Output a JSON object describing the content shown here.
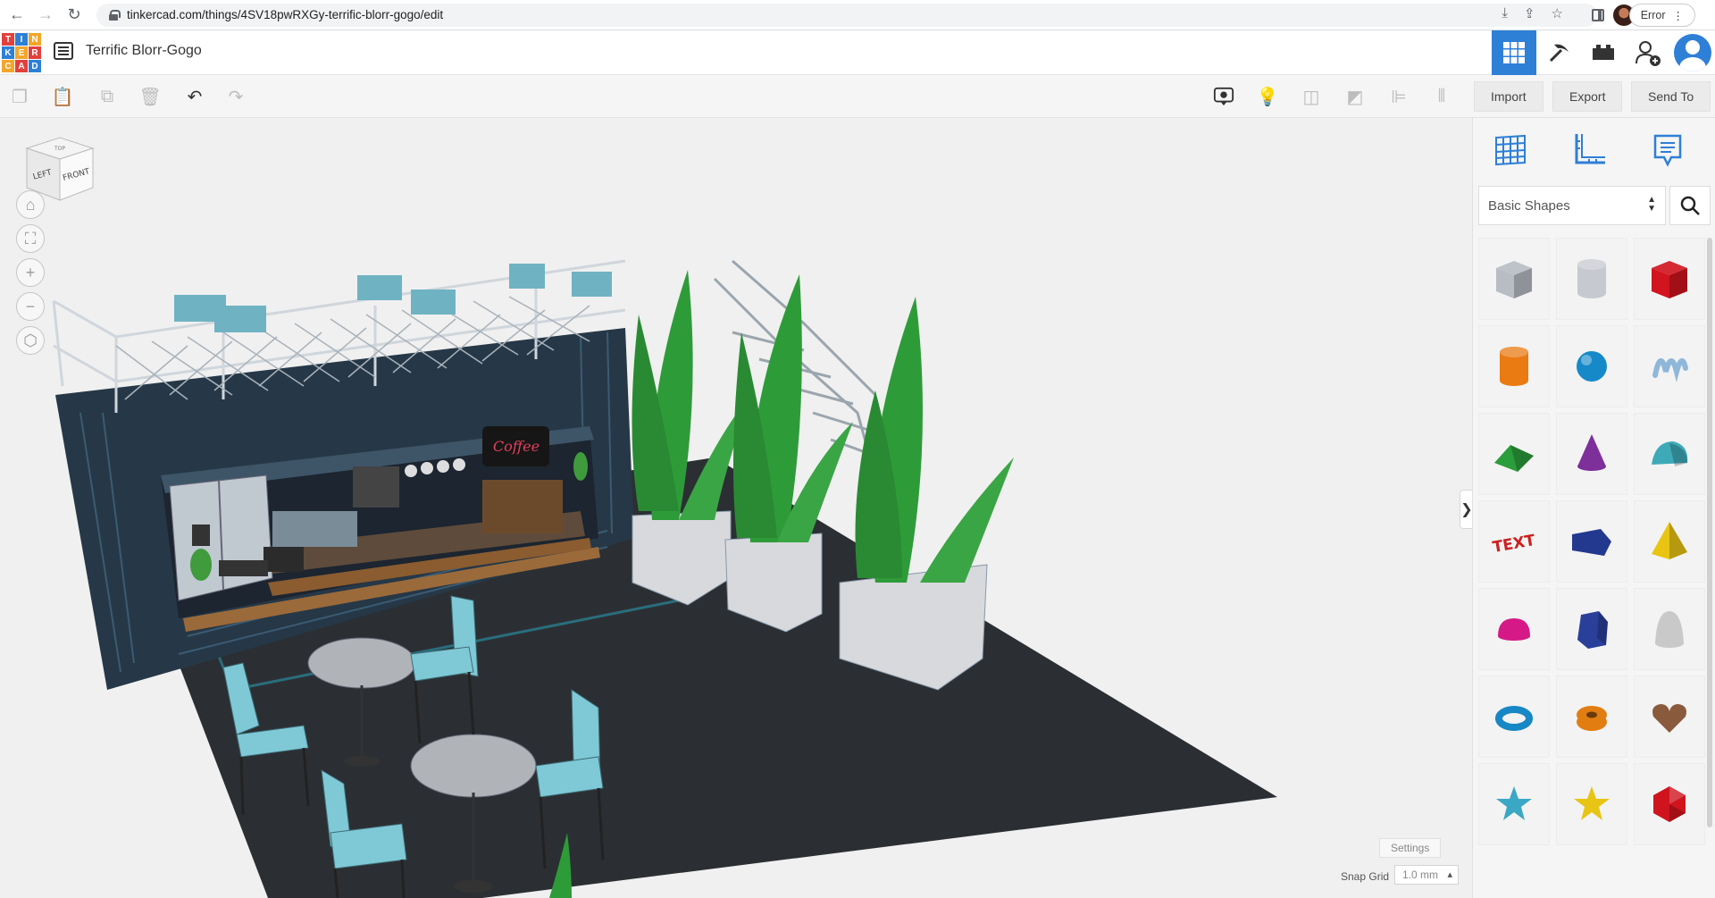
{
  "browser": {
    "url": "tinkercad.com/things/4SV18pwRXGy-terrific-blorr-gogo/edit",
    "error_label": "Error"
  },
  "header": {
    "logo_letters": [
      "T",
      "I",
      "N",
      "K",
      "E",
      "R",
      "C",
      "A",
      "D"
    ],
    "logo_colors": [
      "#e2403c",
      "#2d7fd8",
      "#f4a62a",
      "#2d7fd8",
      "#f4a62a",
      "#e2403c",
      "#f4a62a",
      "#e2403c",
      "#2d7fd8"
    ],
    "title": "Terrific Blorr-Gogo",
    "accent_color": "#2e7fd6"
  },
  "toolbar": {
    "import_label": "Import",
    "export_label": "Export",
    "send_to_label": "Send To"
  },
  "view_cube": {
    "left_label": "LEFT",
    "front_label": "FRONT",
    "top_label": "TOP"
  },
  "workplane": {
    "settings_label": "Settings",
    "snap_grid_label": "Snap Grid",
    "snap_grid_value": "1.0 mm"
  },
  "side_panel": {
    "category": "Basic Shapes",
    "shapes": [
      {
        "name": "box-hole",
        "color": "#b8bcc4"
      },
      {
        "name": "cylinder-hole",
        "color": "#c6c9cf"
      },
      {
        "name": "box",
        "color": "#d1141e"
      },
      {
        "name": "cylinder",
        "color": "#ea7a12"
      },
      {
        "name": "sphere",
        "color": "#1689c9"
      },
      {
        "name": "scribble",
        "color": "#8fb7d9"
      },
      {
        "name": "roof",
        "color": "#2b9d3a"
      },
      {
        "name": "cone",
        "color": "#7d2f9a"
      },
      {
        "name": "round-roof",
        "color": "#3eaab8"
      },
      {
        "name": "text",
        "color": "#cc1f1f"
      },
      {
        "name": "wedge",
        "color": "#23388f"
      },
      {
        "name": "pyramid",
        "color": "#e9c412"
      },
      {
        "name": "half-sphere",
        "color": "#d51a87"
      },
      {
        "name": "polygon",
        "color": "#2a3f9a"
      },
      {
        "name": "paraboloid",
        "color": "#c9c9c9"
      },
      {
        "name": "torus",
        "color": "#1887c5"
      },
      {
        "name": "tube",
        "color": "#e27d12"
      },
      {
        "name": "heart",
        "color": "#8a5a3c"
      },
      {
        "name": "star",
        "color": "#3aa8c4"
      },
      {
        "name": "star-flat",
        "color": "#e8c414"
      },
      {
        "name": "icosahedron",
        "color": "#d0141e"
      }
    ]
  },
  "scene": {
    "sign_text": "Coffee"
  }
}
